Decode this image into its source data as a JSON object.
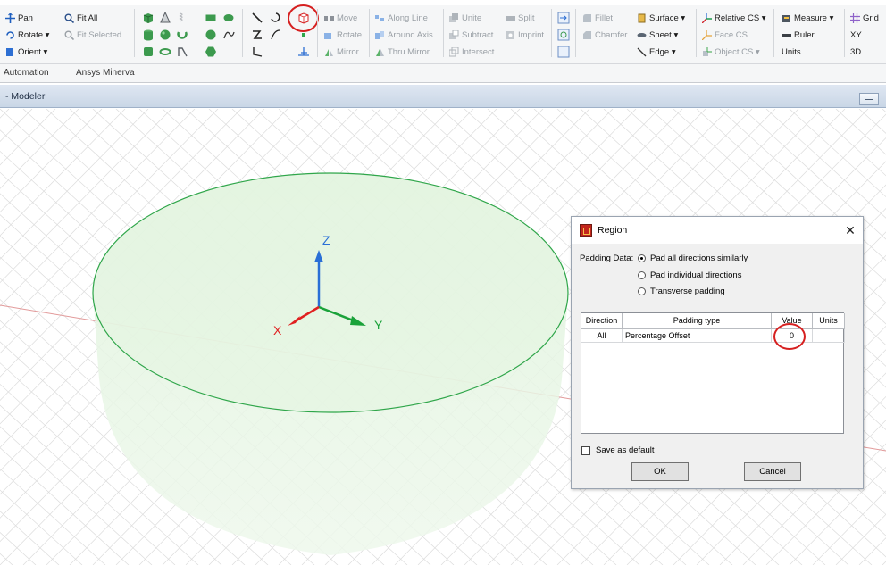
{
  "ribbon": {
    "view_col": {
      "pan": "Pan",
      "rotate": "Rotate ▾",
      "orient": "Orient ▾"
    },
    "fit_col": {
      "fit_all": "Fit All",
      "fit_selected": "Fit Selected"
    },
    "transform": {
      "move": "Move",
      "rotate": "Rotate",
      "mirror": "Mirror"
    },
    "duplicate": {
      "along_line": "Along Line",
      "around_axis": "Around Axis",
      "thru_mirror": "Thru Mirror"
    },
    "boolean": {
      "unite": "Unite",
      "split": "Split",
      "subtract": "Subtract",
      "imprint": "Imprint",
      "intersect": "Intersect"
    },
    "edges": {
      "fillet": "Fillet",
      "chamfer": "Chamfer"
    },
    "geom": {
      "surface": "Surface ▾",
      "sheet": "Sheet ▾",
      "edge": "Edge ▾"
    },
    "cs": {
      "relative": "Relative CS ▾",
      "face": "Face CS",
      "object": "Object CS ▾"
    },
    "measure": {
      "measure": "Measure ▾",
      "ruler": "Ruler",
      "units": "Units"
    },
    "grid": {
      "grid": "Grid",
      "plane": "XY",
      "mode": "3D"
    }
  },
  "tabs": [
    "Automation",
    "Ansys Minerva"
  ],
  "modeler": {
    "title": "- Modeler"
  },
  "axes": {
    "z": "Z",
    "y": "Y",
    "x": "X"
  },
  "dialog": {
    "title": "Region",
    "close": "✕",
    "padding_label": "Padding Data:",
    "options": [
      "Pad all directions similarly",
      "Pad individual directions",
      "Transverse padding"
    ],
    "selected_option": 0,
    "columns": [
      "Direction",
      "Padding type",
      "Value",
      "Units"
    ],
    "rows": [
      {
        "direction": "All",
        "padding_type": "Percentage Offset",
        "value": "0",
        "units": ""
      }
    ],
    "save_default": "Save as default",
    "ok": "OK",
    "cancel": "Cancel"
  },
  "colors": {
    "accent": "#d62020",
    "disk": "#2fa64a",
    "axis_z": "#2a6fd6",
    "axis_y": "#1aa23a",
    "axis_x": "#e02020"
  }
}
